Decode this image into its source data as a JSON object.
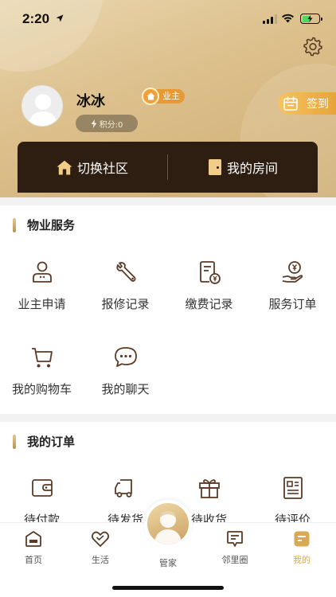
{
  "status_bar": {
    "time": "2:20"
  },
  "profile": {
    "name": "冰冰",
    "role_badge": "业主",
    "points": "积分:0",
    "checkin": "签到"
  },
  "switch_bar": {
    "switch_community": "切换社区",
    "my_room": "我的房间"
  },
  "property_services": {
    "title": "物业服务",
    "items": [
      {
        "label": "业主申请",
        "icon": "owner-person-icon"
      },
      {
        "label": "报修记录",
        "icon": "wrench-icon"
      },
      {
        "label": "缴费记录",
        "icon": "bill-yen-icon"
      },
      {
        "label": "服务订单",
        "icon": "hand-yen-icon"
      },
      {
        "label": "我的购物车",
        "icon": "cart-icon"
      },
      {
        "label": "我的聊天",
        "icon": "chat-bubble-icon"
      }
    ]
  },
  "my_orders": {
    "title": "我的订单",
    "items": [
      {
        "label": "待付款",
        "icon": "wallet-icon"
      },
      {
        "label": "待发货",
        "icon": "truck-icon"
      },
      {
        "label": "待收货",
        "icon": "gift-box-icon"
      },
      {
        "label": "待评价",
        "icon": "review-doc-icon"
      }
    ]
  },
  "tabbar": {
    "items": [
      {
        "label": "首页",
        "icon": "home-icon"
      },
      {
        "label": "生活",
        "icon": "heart-icon"
      },
      {
        "label": "管家",
        "icon": "butler-avatar-icon"
      },
      {
        "label": "邻里圈",
        "icon": "neighborhood-icon"
      },
      {
        "label": "我的",
        "icon": "profile-icon"
      }
    ],
    "active": "我的"
  },
  "colors": {
    "accent": "#d9aa53",
    "dark_bar": "#2e1e12",
    "icon_brown": "#5b3a26"
  }
}
